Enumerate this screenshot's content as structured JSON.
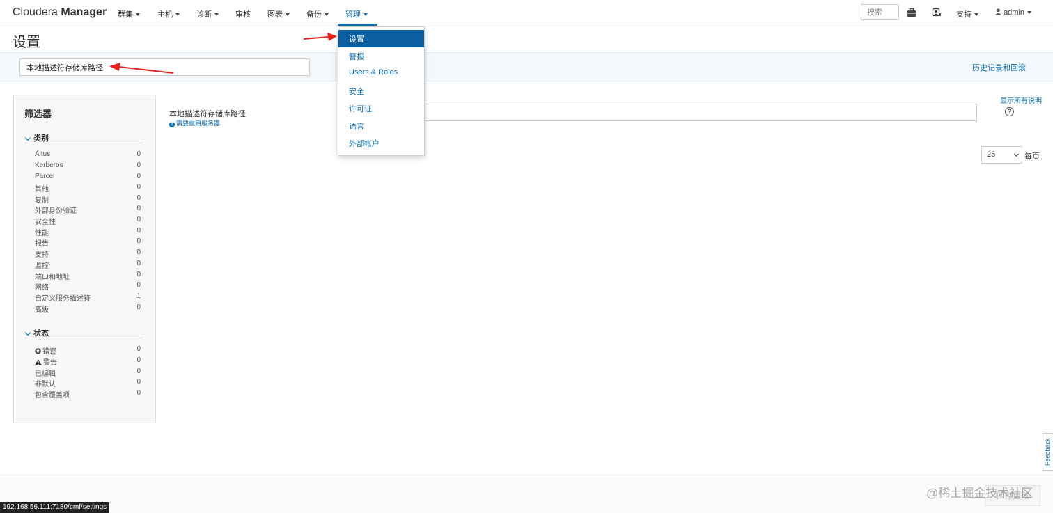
{
  "brand": {
    "light": "Cloudera ",
    "bold": "Manager"
  },
  "nav": {
    "items": [
      {
        "label": "群集"
      },
      {
        "label": "主机"
      },
      {
        "label": "诊断"
      },
      {
        "label": "审核"
      },
      {
        "label": "图表"
      },
      {
        "label": "备份"
      },
      {
        "label": "管理"
      }
    ],
    "search_placeholder": "搜索",
    "support": "支持",
    "user": "admin",
    "icons": [
      "briefcase-icon",
      "contact-icon",
      "user-icon"
    ]
  },
  "page": {
    "title": "设置",
    "filter_value": "本地描述符存储库路径",
    "history_link": "历史记录和回滚"
  },
  "sidebar": {
    "title": "筛选器",
    "category": {
      "heading": "类别",
      "items": [
        {
          "label": "Altus",
          "count": "0"
        },
        {
          "label": "Kerberos",
          "count": "0"
        },
        {
          "label": "Parcel",
          "count": "0"
        },
        {
          "label": "其他",
          "count": "0"
        },
        {
          "label": "复制",
          "count": "0"
        },
        {
          "label": "外部身份验证",
          "count": "0"
        },
        {
          "label": "安全性",
          "count": "0"
        },
        {
          "label": "性能",
          "count": "0"
        },
        {
          "label": "报告",
          "count": "0"
        },
        {
          "label": "支持",
          "count": "0"
        },
        {
          "label": "监控",
          "count": "0"
        },
        {
          "label": "端口和地址",
          "count": "0"
        },
        {
          "label": "网络",
          "count": "0"
        },
        {
          "label": "自定义服务描述符",
          "count": "1"
        },
        {
          "label": "高级",
          "count": "0"
        }
      ]
    },
    "status": {
      "heading": "状态",
      "items": [
        {
          "label": "错误",
          "count": "0",
          "icon": "error-icon"
        },
        {
          "label": "警告",
          "count": "0",
          "icon": "warning-icon"
        },
        {
          "label": "已编辑",
          "count": "0"
        },
        {
          "label": "非默认",
          "count": "0"
        },
        {
          "label": "包含覆盖项",
          "count": "0"
        }
      ]
    }
  },
  "setting": {
    "label": "本地描述符存储库路径",
    "restart_note": "需要重启服务器",
    "value": ""
  },
  "show_all_desc": "显示所有说明",
  "pagination": {
    "page_size": "25",
    "per_page": "每页"
  },
  "dropdown": {
    "items": [
      {
        "label": "设置"
      },
      {
        "label": "警报"
      },
      {
        "label": "Users & Roles"
      },
      {
        "label": "安全"
      },
      {
        "label": "许可证"
      },
      {
        "label": "语言"
      },
      {
        "label": "外部帐户"
      }
    ]
  },
  "footer": {
    "save_label": "保存更改"
  },
  "watermark": "@稀土掘金技术社区",
  "status_url": "192.168.56.111:7180/cmf/settings",
  "feedback_label": "Feedback",
  "colors": {
    "accent": "#0a6fb3",
    "selected": "#0a5fa0",
    "annotation": "#e8211c"
  }
}
